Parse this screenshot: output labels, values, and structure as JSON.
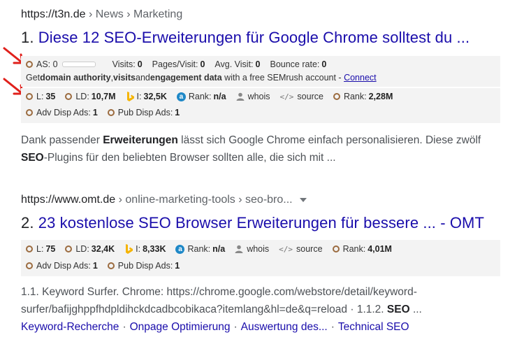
{
  "results": [
    {
      "url_host": "https://t3n.de",
      "url_path": " › News › Marketing",
      "number": "1.",
      "title": "Diese 12 SEO-Erweiterungen für Google Chrome solltest du ...",
      "semrush": {
        "as_label": "AS:",
        "as_value": "0",
        "visits_label": "Visits:",
        "visits_value": "0",
        "ppv_label": "Pages/Visit:",
        "ppv_value": "0",
        "avg_label": "Avg. Visit:",
        "avg_value": "0",
        "bounce_label": "Bounce rate:",
        "bounce_value": "0",
        "promo_pre": "Get ",
        "promo_b1": "domain authority",
        "promo_mid1": ", ",
        "promo_b2": "visits",
        "promo_mid2": " and ",
        "promo_b3": "engagement data",
        "promo_post": " with a free SEMrush account - ",
        "promo_link": "Connect"
      },
      "metrics": {
        "l_label": "L:",
        "l_value": "35",
        "ld_label": "LD:",
        "ld_value": "10,7M",
        "i_label": "I:",
        "i_value": "32,5K",
        "rank_label": "Rank:",
        "rank_value": "n/a",
        "whois": "whois",
        "source": "source",
        "rank2_label": "Rank:",
        "rank2_value": "2,28M",
        "adv_label": "Adv Disp Ads:",
        "adv_value": "1",
        "pub_label": "Pub Disp Ads:",
        "pub_value": "1"
      },
      "snippet_1": "Dank passender ",
      "snippet_b1": "Erweiterungen",
      "snippet_2": " lässt sich Google Chrome einfach personalisieren. Diese zwölf",
      "snippet_b2": "SEO",
      "snippet_3": "-Plugins für den beliebten Browser sollten alle, die sich mit ..."
    },
    {
      "url_host": "https://www.omt.de",
      "url_path": " › online-marketing-tools › seo-bro...",
      "number": "2.",
      "title": "23 kostenlose SEO Browser Erweiterungen für bessere ... - OMT",
      "metrics": {
        "l_label": "L:",
        "l_value": "75",
        "ld_label": "LD:",
        "ld_value": "32,4K",
        "i_label": "I:",
        "i_value": "8,33K",
        "rank_label": "Rank:",
        "rank_value": "n/a",
        "whois": "whois",
        "source": "source",
        "rank2_label": "Rank:",
        "rank2_value": "4,01M",
        "adv_label": "Adv Disp Ads:",
        "adv_value": "1",
        "pub_label": "Pub Disp Ads:",
        "pub_value": "1"
      },
      "snippet_line1": "1.1. Keyword Surfer. Chrome: https://chrome.google.com/webstore/detail/keyword-",
      "snippet_line2": "surfer/bafijghppfhdpldihckdcadbcobikaca?itemlang&hl=de&q=reload · 1.1.2. ",
      "snippet_b": "SEO",
      "snippet_end": " ...",
      "sitelinks": [
        "Keyword-Recherche",
        "Onpage Optimierung",
        "Auswertung des...",
        "Technical SEO"
      ]
    }
  ],
  "colors": {
    "link": "#1a0dab",
    "arrow": "#e0201b",
    "bar_bg": "#f3f3f3",
    "icon_brown": "#9b6b3f"
  }
}
